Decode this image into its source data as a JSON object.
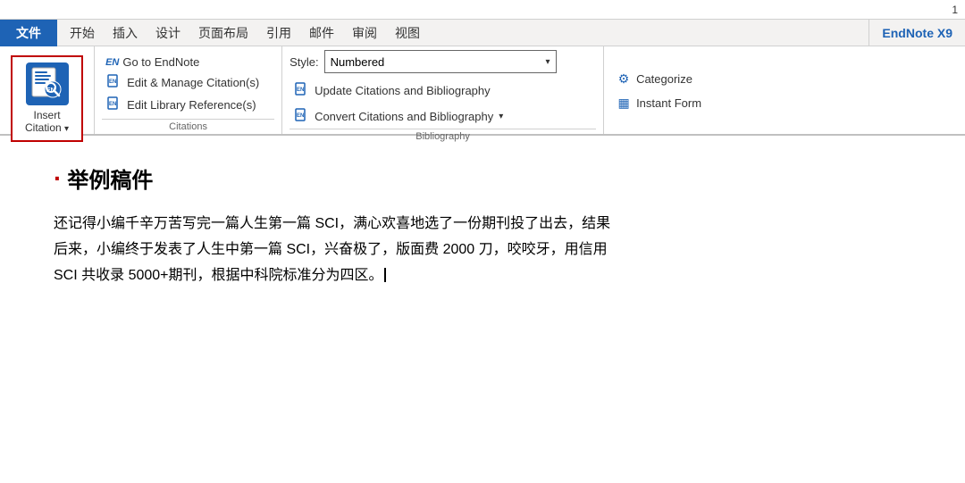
{
  "topbar": {
    "page_number": "1"
  },
  "menubar": {
    "file_label": "文件",
    "items": [
      {
        "label": "开始"
      },
      {
        "label": "插入"
      },
      {
        "label": "设计"
      },
      {
        "label": "页面布局"
      },
      {
        "label": "引用"
      },
      {
        "label": "邮件"
      },
      {
        "label": "审阅"
      },
      {
        "label": "视图"
      },
      {
        "label": "EndNote X9"
      }
    ]
  },
  "ribbon": {
    "insert_citation": {
      "label_line1": "Insert",
      "label_line2": "Citation",
      "dropdown_arrow": "▾"
    },
    "citations_group": {
      "title": "Citations",
      "buttons": [
        {
          "prefix": "EN",
          "label": "Go to EndNote"
        },
        {
          "prefix": "EN",
          "label": "Edit & Manage Citation(s)"
        },
        {
          "prefix": "EN",
          "label": "Edit Library Reference(s)"
        }
      ]
    },
    "bibliography_group": {
      "title": "Bibliography",
      "style_label": "Style:",
      "style_value": "Numbered",
      "style_arrow": "▾",
      "buttons": [
        {
          "prefix": "EN",
          "label": "Update Citations and Bibliography"
        },
        {
          "prefix": "EN",
          "label": "Convert Citations and Bibliography",
          "has_arrow": true
        }
      ]
    },
    "right_group": {
      "buttons": [
        {
          "prefix": "⚙",
          "label": "Categorize"
        },
        {
          "prefix": "▦",
          "label": "Instant Form"
        }
      ]
    }
  },
  "document": {
    "title_bullet": "·",
    "title_text": "举例稿件",
    "paragraphs": [
      "还记得小编千辛万苦写完一篇人生第一篇 SCI，满心欢喜地选了一份期刊投了出去，结果",
      "后来，小编终于发表了人生中第一篇 SCI，兴奋极了，版面费 2000 刀，咬咬牙，用信用",
      "SCI 共收录 5000+期刊，根据中科院标准分为四区。"
    ],
    "cursor_after": "。"
  }
}
